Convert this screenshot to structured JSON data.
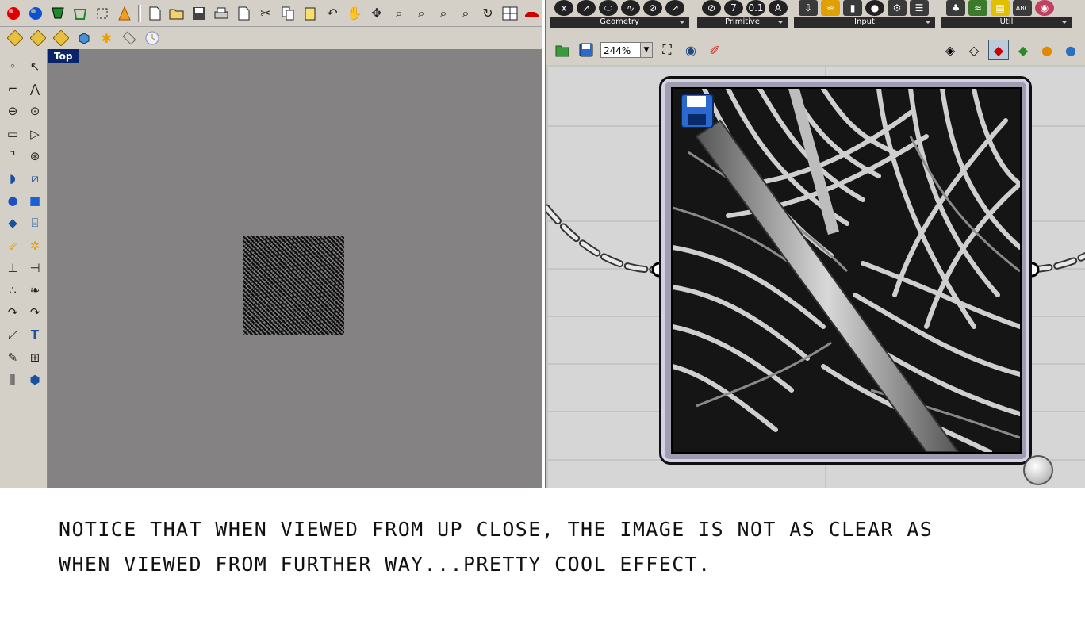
{
  "rhino": {
    "viewport_label": "Top",
    "toolbar1_icons": [
      "sphere-red-icon",
      "sphere-blue-icon",
      "shield-icon",
      "cube-icon",
      "frame-icon",
      "cone-icon",
      "new-file-icon",
      "open-folder-icon",
      "save-icon",
      "print-icon",
      "import-icon",
      "cut-icon",
      "copy-icon",
      "paste-icon",
      "undo-icon",
      "pan-hand-icon",
      "rotate-icon",
      "zoom-icon",
      "zoom-window-icon",
      "zoom-extents-icon",
      "zoom-selected-icon",
      "rotate-view-icon",
      "four-viewports-icon",
      "car-icon"
    ],
    "toolbar2_icons": [
      "osnap-icon",
      "tag-icon",
      "tag-alt-icon",
      "box-icon",
      "star-icon",
      "ruler-icon",
      "clock-icon"
    ],
    "sidebar_icons": [
      "point-icon",
      "select-arrow-icon",
      "polyline-icon",
      "curve-icon",
      "ellipse-icon",
      "circle-icon",
      "rectangle-icon",
      "polygon-icon",
      "fillet-icon",
      "arc-icon",
      "surface-icon",
      "surface-edit-icon",
      "solid-union-icon",
      "box-solid-icon",
      "plane-icon",
      "cylinder-icon",
      "vector-icon",
      "gear-icon",
      "dimension-icon",
      "trim-icon",
      "group-icon",
      "boolean-icon",
      "curve-flow-icon",
      "rotate-curve-icon",
      "transform-icon",
      "text-icon",
      "edit-icon",
      "array-icon",
      "grid-icon",
      "block-icon"
    ]
  },
  "grasshopper": {
    "tab_groups": [
      {
        "label": "Geometry",
        "icons": [
          "x",
          "↗",
          "⬭",
          "∿",
          "⊘",
          "↗"
        ]
      },
      {
        "label": "Primitive",
        "icons": [
          "⊘",
          "7",
          "0.1",
          "A"
        ]
      },
      {
        "label": "Input",
        "icons": [
          "⇩",
          "≋",
          "▮",
          "●",
          "⚙",
          "☰"
        ]
      },
      {
        "label": "Util",
        "icons": [
          "♣",
          "≈",
          "▤",
          "ABC",
          "◉"
        ]
      }
    ],
    "zoom_value": "244%",
    "toolbar_icons": [
      "open-file-icon",
      "save-file-icon",
      "zoom-extents-icon",
      "eye-icon",
      "brush-icon",
      "layer-icon",
      "cube-icon",
      "preview-red-icon",
      "preview-green-icon",
      "shading-icon",
      "sphere-icon"
    ]
  },
  "caption": {
    "line1": "NOTICE THAT WHEN VIEWED FROM UP CLOSE, THE IMAGE IS NOT AS CLEAR AS",
    "line2": "WHEN VIEWED FROM FURTHER WAY...PRETTY COOL EFFECT."
  }
}
